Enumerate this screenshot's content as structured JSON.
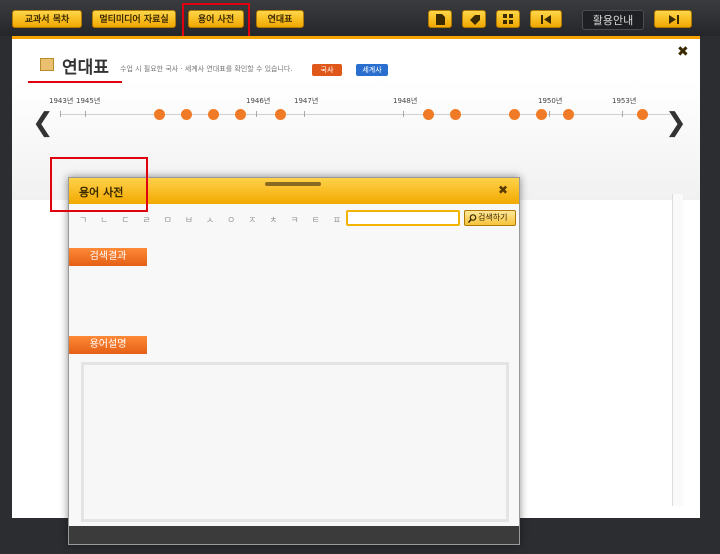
{
  "toolbar": {
    "buttons": [
      {
        "label": "교과서 목차"
      },
      {
        "label": "멀티미디어 자료실"
      },
      {
        "label": "용어 사전"
      },
      {
        "label": "연대표"
      }
    ],
    "guide_label": "활용안내"
  },
  "header": {
    "title": "연대표",
    "subtitle": "수업 시 필요한 국사 · 세계사 연대표를 확인할 수 있습니다.",
    "btn_korea": "국사",
    "btn_world": "세계사"
  },
  "timeline": {
    "years": [
      "1943년",
      "1945년",
      "1946년",
      "1947년",
      "1948년",
      "1950년",
      "1953년"
    ]
  },
  "dialog": {
    "title": "용어 사전",
    "letters": "ㄱ ㄴ ㄷ ㄹ ㅁ ㅂ ㅅ ㅇ ㅈ ㅊ ㅋ ㅌ ㅍ ㅎ",
    "search_value": "",
    "search_button": "검색하기",
    "result_header": "검색결과",
    "desc_header": "용어설명"
  },
  "colors": {
    "accent_orange": "#f07a25",
    "toolbar_yellow": "#f2a900",
    "highlight_red": "#e00010"
  }
}
